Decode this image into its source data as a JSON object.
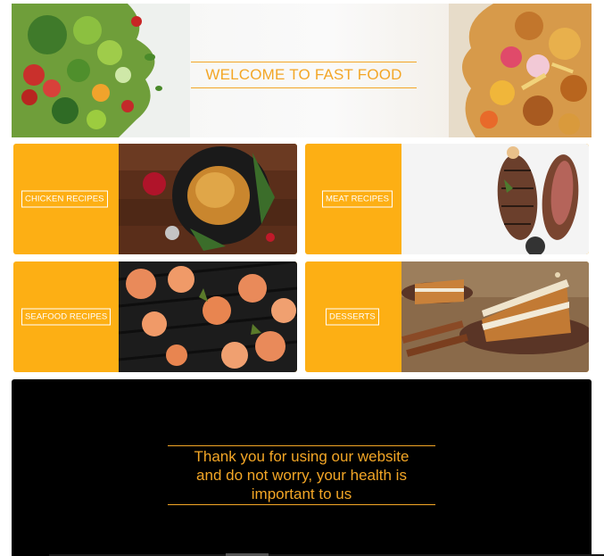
{
  "hero": {
    "title": "WELCOME TO FAST FOOD",
    "accent": "#f3a626"
  },
  "categories": [
    {
      "label": "CHICKEN RECIPES",
      "image": "roast-chicken-photo"
    },
    {
      "label": "MEAT RECIPES",
      "image": "grilled-steak-photo"
    },
    {
      "label": "SEAFOOD RECIPES",
      "image": "grilled-shrimp-photo"
    },
    {
      "label": "DESSERTS",
      "image": "carrot-cake-photo"
    }
  ],
  "footer": {
    "message_line1": "Thank you for using our website",
    "message_line2": "and do not worry, your health is",
    "message_line3": "important to us"
  },
  "colors": {
    "card_bg": "#fdaf14",
    "footer_bg": "#000000",
    "accent": "#f3a626"
  }
}
